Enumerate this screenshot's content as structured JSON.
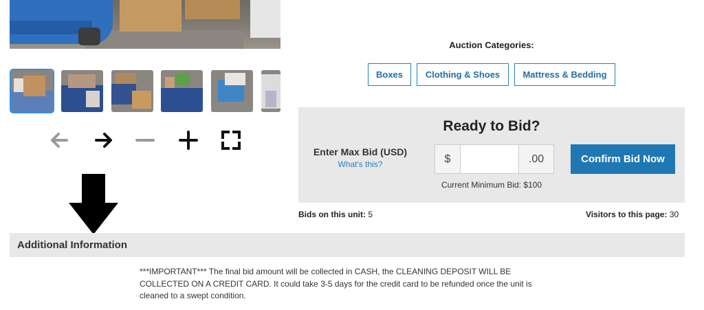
{
  "gallery": {
    "controls": [
      {
        "name": "prev-arrow-icon",
        "label": "previous"
      },
      {
        "name": "next-arrow-icon",
        "label": "next"
      },
      {
        "name": "zoom-out-icon",
        "label": "zoom out"
      },
      {
        "name": "zoom-in-icon",
        "label": "zoom in"
      },
      {
        "name": "fullscreen-icon",
        "label": "fullscreen"
      }
    ]
  },
  "categories": {
    "heading": "Auction Categories:",
    "items": [
      "Boxes",
      "Clothing & Shoes",
      "Mattress & Bedding"
    ]
  },
  "bid": {
    "title": "Ready to Bid?",
    "max_bid_label": "Enter Max Bid (USD)",
    "whats_this": "What's this?",
    "currency_prefix": "$",
    "cents_suffix": ".00",
    "input_value": "",
    "min_bid_text": "Current Minimum Bid: $100",
    "confirm_label": "Confirm Bid Now"
  },
  "stats": {
    "bids_label": "Bids on this unit:",
    "bids_value": "5",
    "visitors_label": "Visitors to this page:",
    "visitors_value": "30"
  },
  "additional": {
    "title": "Additional Information",
    "text": "***IMPORTANT*** The final bid amount will be collected in CASH, the CLEANING DEPOSIT WILL BE COLLECTED ON A CREDIT CARD. It could take 3-5 days for the credit card to be refunded once the unit is cleaned to a swept condition."
  },
  "colors": {
    "accent": "#1f78b4",
    "panel_bg": "#e8e8e8",
    "link": "#1f7fc4"
  }
}
